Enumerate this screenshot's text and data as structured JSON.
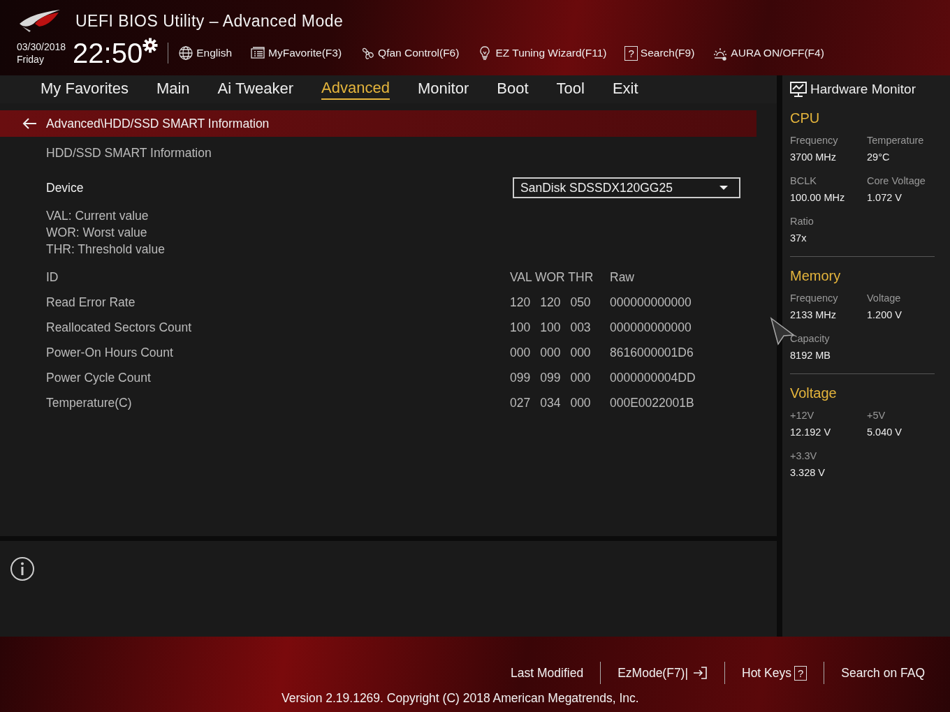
{
  "window": {
    "title": "UEFI BIOS Utility – Advanced Mode"
  },
  "clock": {
    "date": "03/30/2018",
    "day": "Friday",
    "time": "22:50"
  },
  "toolbar": [
    {
      "label": "English",
      "kind": "globe"
    },
    {
      "label": "MyFavorite(F3)",
      "kind": "list"
    },
    {
      "label": "Qfan Control(F6)",
      "kind": "fan"
    },
    {
      "label": "EZ Tuning Wizard(F11)",
      "kind": "bulb"
    },
    {
      "label": "Search(F9)",
      "kind": "boxed",
      "glyph": "?"
    },
    {
      "label": "AURA ON/OFF(F4)",
      "kind": "aura"
    }
  ],
  "tabs": [
    {
      "label": "My Favorites",
      "selected": false
    },
    {
      "label": "Main",
      "selected": false
    },
    {
      "label": "Ai Tweaker",
      "selected": false
    },
    {
      "label": "Advanced",
      "selected": true
    },
    {
      "label": "Monitor",
      "selected": false
    },
    {
      "label": "Boot",
      "selected": false
    },
    {
      "label": "Tool",
      "selected": false
    },
    {
      "label": "Exit",
      "selected": false
    }
  ],
  "breadcrumb": "Advanced\\HDD/SSD SMART Information",
  "section_title": "HDD/SSD SMART Information",
  "device": {
    "label": "Device",
    "value": "SanDisk SDSSDX120GG25"
  },
  "legend": [
    "VAL:  Current value",
    "WOR: Worst value",
    "THR:  Threshold value"
  ],
  "smart_table": {
    "columns": [
      "ID",
      "VAL WOR THR",
      "Raw"
    ],
    "rows": [
      {
        "name": "Read Error Rate",
        "val": "120",
        "wor": "120",
        "thr": "050",
        "raw": "000000000000"
      },
      {
        "name": "Reallocated Sectors Count",
        "val": "100",
        "wor": "100",
        "thr": "003",
        "raw": "000000000000"
      },
      {
        "name": "Power-On Hours Count",
        "val": "000",
        "wor": "000",
        "thr": "000",
        "raw": "8616000001D6"
      },
      {
        "name": "Power Cycle Count",
        "val": "099",
        "wor": "099",
        "thr": "000",
        "raw": "0000000004DD"
      },
      {
        "name": "Temperature(C)",
        "val": "027",
        "wor": "034",
        "thr": "000",
        "raw": "000E0022001B"
      }
    ]
  },
  "hardware_monitor": {
    "title": "Hardware Monitor",
    "sections": [
      {
        "title": "CPU",
        "items": [
          {
            "label": "Frequency",
            "value": "3700 MHz"
          },
          {
            "label": "Temperature",
            "value": "29°C"
          },
          {
            "label": "BCLK",
            "value": "100.00 MHz"
          },
          {
            "label": "Core Voltage",
            "value": "1.072 V"
          },
          {
            "label": "Ratio",
            "value": "37x"
          }
        ]
      },
      {
        "title": "Memory",
        "items": [
          {
            "label": "Frequency",
            "value": "2133 MHz"
          },
          {
            "label": "Voltage",
            "value": "1.200 V"
          },
          {
            "label": "Capacity",
            "value": "8192 MB"
          }
        ]
      },
      {
        "title": "Voltage",
        "items": [
          {
            "label": "+12V",
            "value": "12.192 V"
          },
          {
            "label": "+5V",
            "value": "5.040 V"
          },
          {
            "label": "+3.3V",
            "value": "3.328 V"
          }
        ]
      }
    ]
  },
  "footer": {
    "links": [
      {
        "label": "Last Modified",
        "kind": "plain"
      },
      {
        "label": "EzMode(F7)|",
        "kind": "exit"
      },
      {
        "label": "Hot Keys",
        "kind": "boxed",
        "glyph": "?"
      },
      {
        "label": "Search on FAQ",
        "kind": "plain"
      }
    ],
    "version": "Version 2.19.1269. Copyright (C) 2018 American Megatrends, Inc."
  }
}
